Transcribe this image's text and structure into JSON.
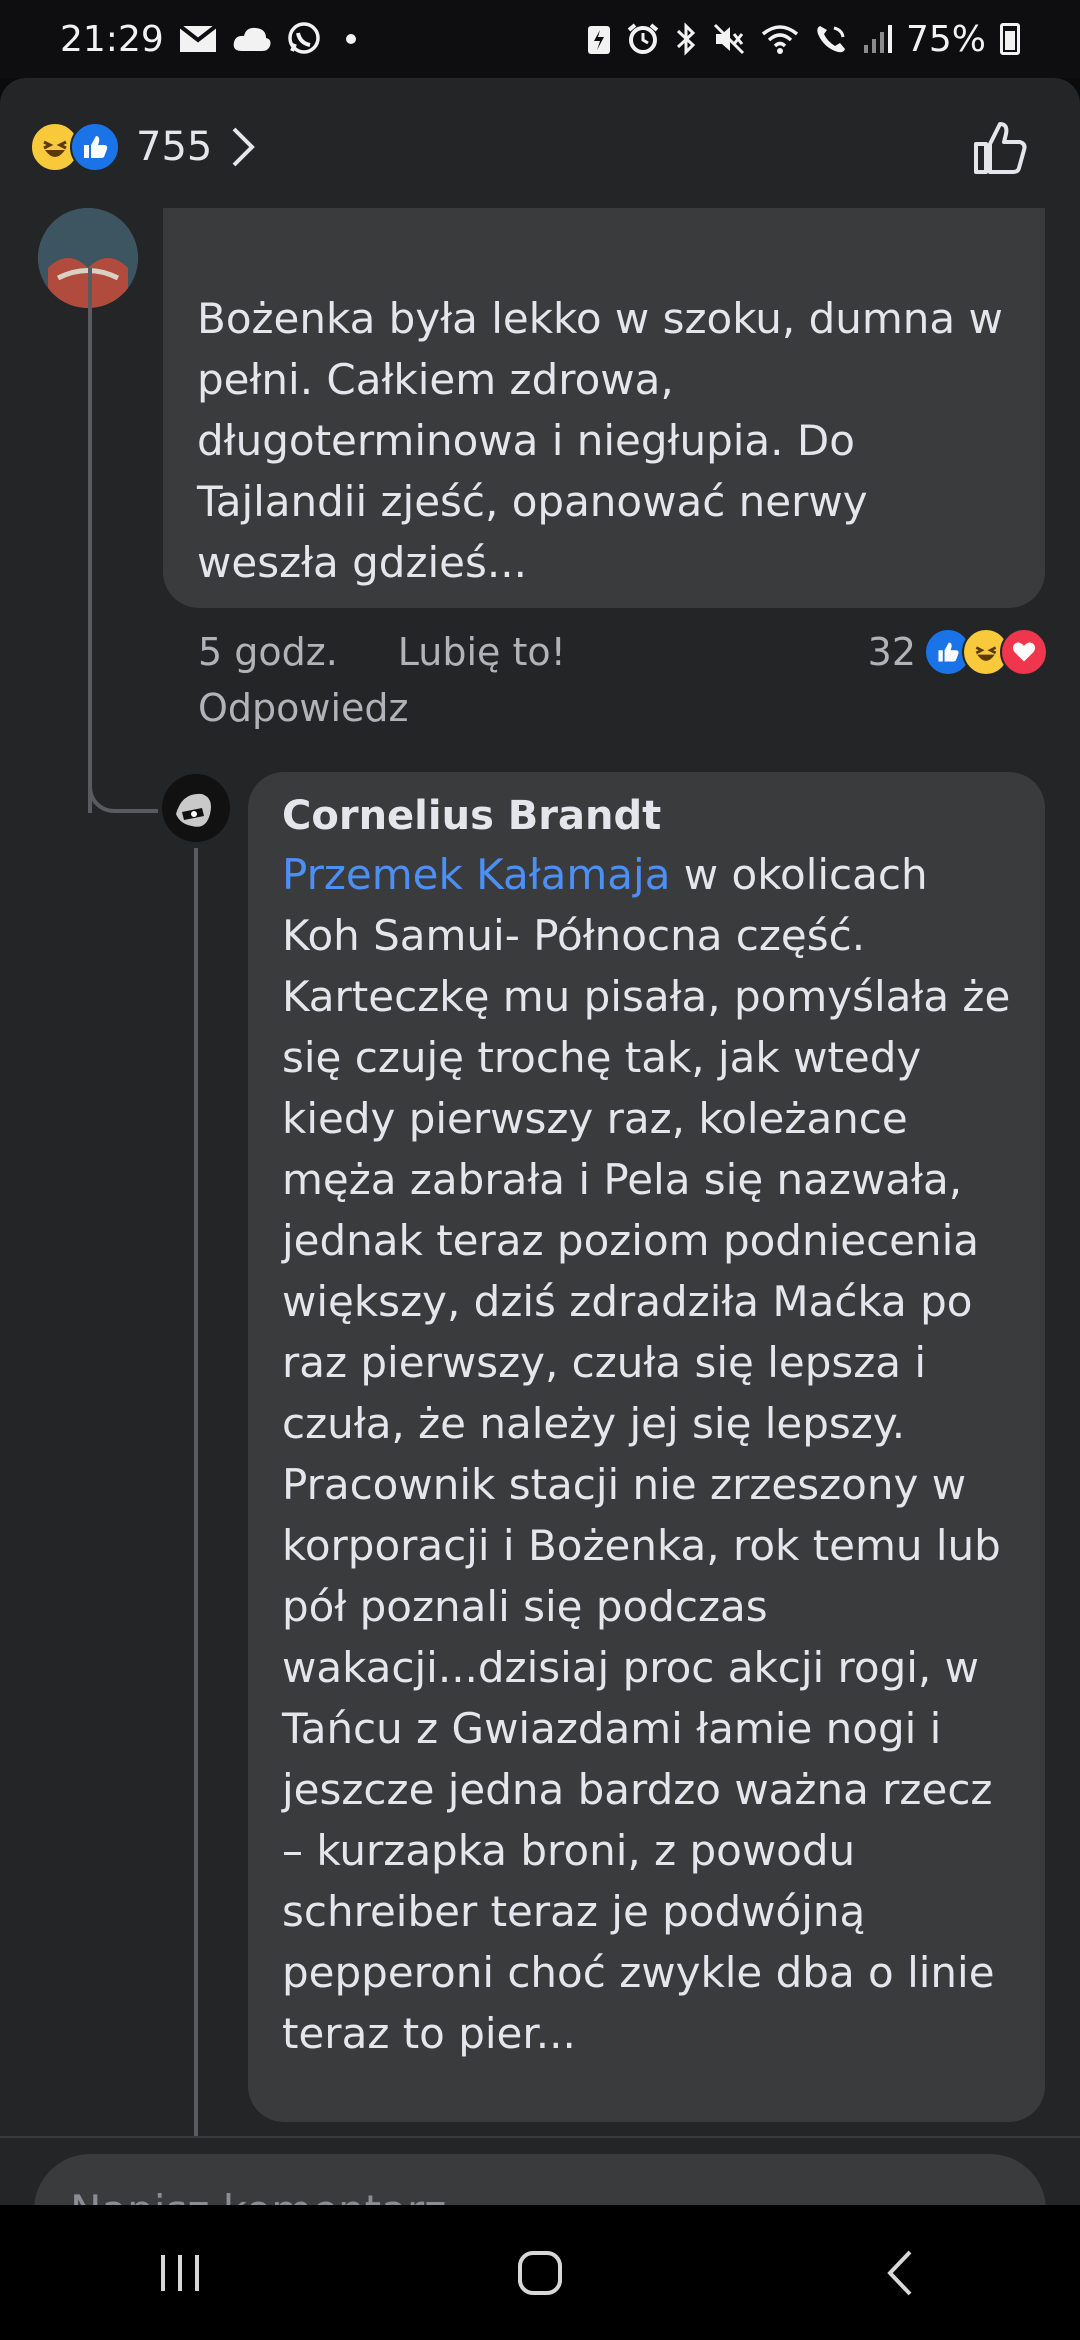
{
  "status_bar": {
    "time": "21:29",
    "battery": "75%",
    "icons": [
      "mail-icon",
      "cloud-icon",
      "whatsapp-icon",
      "battery-saver-icon",
      "alarm-icon",
      "bluetooth-icon",
      "mute-icon",
      "wifi-icon",
      "wifi-call-icon",
      "signal-icon",
      "battery-icon"
    ]
  },
  "header": {
    "reaction_count": "755",
    "reaction_icons": [
      "haha-reaction-icon",
      "like-reaction-icon"
    ]
  },
  "comment1": {
    "text": "Bożenka była lekko w szoku, dumna w pełni. Całkiem zdrowa, długoterminowa i niegłupia. Do Tajlandii zjeść, opanować nerwy weszła gdzieś...",
    "time": "5 godz.",
    "like_label": "Lubię to!",
    "reply_label": "Odpowiedz",
    "reaction_count": "32"
  },
  "comment2": {
    "author": "Cornelius Brandt",
    "mention": "Przemek Kałamaja",
    "text": " w okolicach Koh Samui- Północna część. Karteczkę mu pisała, pomyślała że się czuję trochę tak, jak wtedy kiedy pierwszy raz, koleżance męża zabrała i Pela się nazwała, jednak teraz poziom podniecenia większy, dziś zdradziła Maćka po raz pierwszy, czuła się lepsza i czuła, że należy jej się lepszy. Pracownik stacji nie zrzeszony w korporacji i Bożenka, rok temu lub pół poznali się podczas wakacji...dzisiaj proc akcji rogi, w Tańcu z Gwiazdami łamie nogi i jeszcze jedna bardzo ważna rzecz – kurzapka broni, z powodu schreiber teraz je podwójną pepperoni choć zwykle dba o linie teraz to pier..."
  },
  "composer": {
    "placeholder": "Napisz komentarz..."
  },
  "colors": {
    "sheet_bg": "#242526",
    "bubble_bg": "#3a3b3c",
    "mention": "#4c8ff5",
    "like_blue": "#1a74e8",
    "love_red": "#f0364d",
    "haha_yellow": "#f7c93b"
  }
}
